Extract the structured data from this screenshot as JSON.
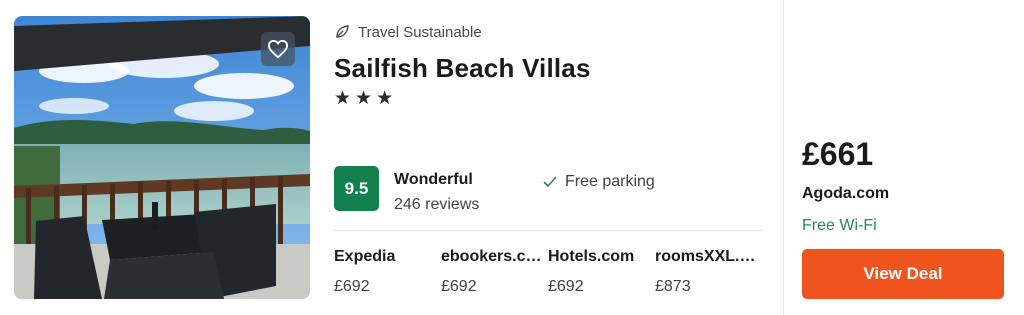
{
  "hotel": {
    "sustainability_label": "Travel Sustainable",
    "name": "Sailfish Beach Villas",
    "stars_display": "★★★",
    "star_count": 3,
    "score": "9.5",
    "rating_word": "Wonderful",
    "reviews": "246 reviews",
    "amenity": "Free parking"
  },
  "providers": [
    {
      "name": "Expedia",
      "price": "£692"
    },
    {
      "name": "ebookers.com",
      "price": "£692"
    },
    {
      "name": "Hotels.com",
      "price": "£692"
    },
    {
      "name": "roomsXXL.com",
      "price": "£873"
    }
  ],
  "deal": {
    "price": "£661",
    "provider": "Agoda.com",
    "amenity": "Free Wi-Fi",
    "button_label": "View Deal"
  },
  "icons": {
    "favorite": "heart-icon",
    "sustain": "leaf-icon",
    "amenity": "check-icon"
  },
  "colors": {
    "score_badge": "#12814e",
    "cta": "#f0541e",
    "amenity_green": "#1f8a55"
  }
}
